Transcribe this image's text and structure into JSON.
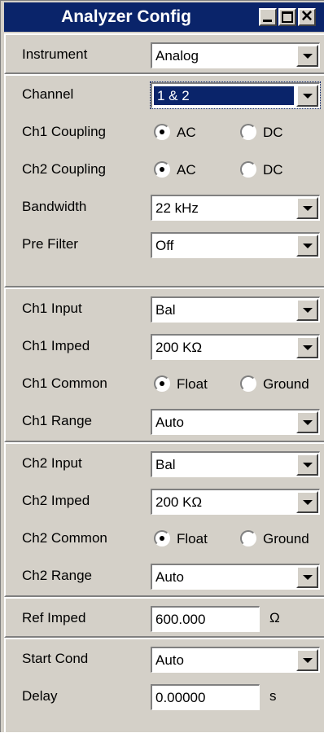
{
  "window": {
    "title": "Analyzer Config"
  },
  "instrument": {
    "label": "Instrument",
    "value": "Analog"
  },
  "channel": {
    "label": "Channel",
    "value": "1 & 2"
  },
  "ch1_coupling": {
    "label": "Ch1 Coupling",
    "options": [
      "AC",
      "DC"
    ],
    "selected": "AC"
  },
  "ch2_coupling": {
    "label": "Ch2 Coupling",
    "options": [
      "AC",
      "DC"
    ],
    "selected": "AC"
  },
  "bandwidth": {
    "label": "Bandwidth",
    "value": "22 kHz"
  },
  "pre_filter": {
    "label": "Pre Filter",
    "value": "Off"
  },
  "ch1_input": {
    "label": "Ch1 Input",
    "value": "Bal"
  },
  "ch1_imped": {
    "label": "Ch1 Imped",
    "value": "200 KΩ"
  },
  "ch1_common": {
    "label": "Ch1 Common",
    "options": [
      "Float",
      "Ground"
    ],
    "selected": "Float"
  },
  "ch1_range": {
    "label": "Ch1 Range",
    "value": "Auto"
  },
  "ch2_input": {
    "label": "Ch2 Input",
    "value": "Bal"
  },
  "ch2_imped": {
    "label": "Ch2 Imped",
    "value": "200 KΩ"
  },
  "ch2_common": {
    "label": "Ch2 Common",
    "options": [
      "Float",
      "Ground"
    ],
    "selected": "Float"
  },
  "ch2_range": {
    "label": "Ch2 Range",
    "value": "Auto"
  },
  "ref_imped": {
    "label": "Ref Imped",
    "value": "600.000",
    "unit": "Ω"
  },
  "start_cond": {
    "label": "Start Cond",
    "value": "Auto"
  },
  "delay": {
    "label": "Delay",
    "value": "0.00000",
    "unit": "s"
  }
}
